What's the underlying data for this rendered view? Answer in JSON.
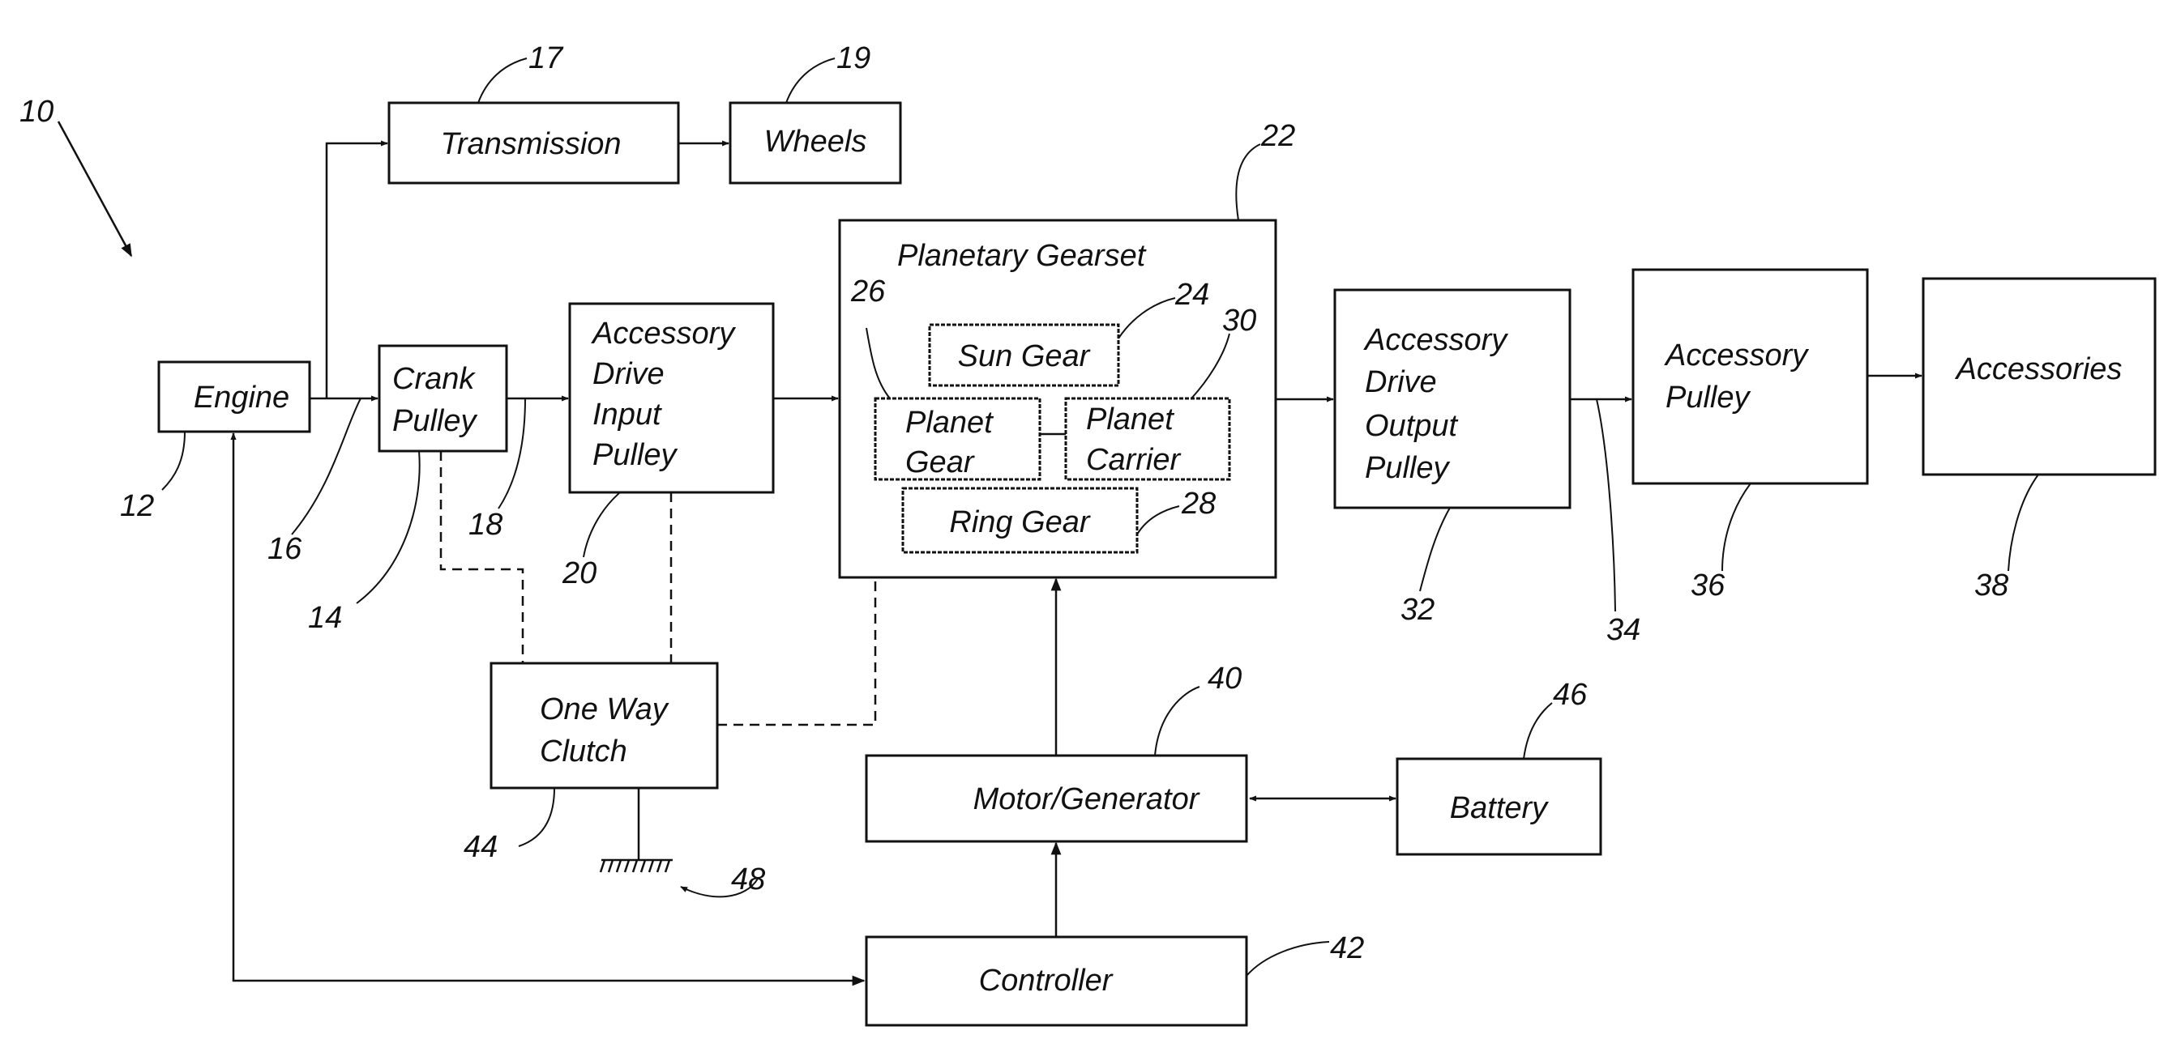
{
  "figure": {
    "system_ref": "10",
    "colors": {
      "ink": "#111111",
      "paper": "#ffffff"
    }
  },
  "blocks": {
    "engine": {
      "lines": [
        "Engine"
      ],
      "ref": "12"
    },
    "crank_pulley": {
      "lines": [
        "Crank",
        "Pulley"
      ],
      "ref": "14"
    },
    "transmission": {
      "lines": [
        "Transmission"
      ],
      "ref": "17"
    },
    "wheels": {
      "lines": [
        "Wheels"
      ],
      "ref": "19"
    },
    "accessory_drive_input_pulley": {
      "lines": [
        "Accessory",
        "Drive",
        "Input",
        "Pulley"
      ],
      "ref": "20"
    },
    "planetary_gearset": {
      "lines": [
        "Planetary Gearset"
      ],
      "ref": "22"
    },
    "sun_gear": {
      "lines": [
        "Sun Gear"
      ],
      "ref": "24"
    },
    "planet_gear": {
      "lines": [
        "Planet",
        "Gear"
      ],
      "ref": "26"
    },
    "ring_gear": {
      "lines": [
        "Ring Gear"
      ],
      "ref": "28"
    },
    "planet_carrier": {
      "lines": [
        "Planet",
        "Carrier"
      ],
      "ref": "30"
    },
    "accessory_drive_output_pulley": {
      "lines": [
        "Accessory",
        "Drive",
        "Output",
        "Pulley"
      ],
      "ref": "32"
    },
    "accessory_pulley": {
      "lines": [
        "Accessory",
        "Pulley"
      ],
      "ref": "36"
    },
    "accessories": {
      "lines": [
        "Accessories"
      ],
      "ref": "38"
    },
    "motor_generator": {
      "lines": [
        "Motor/Generator"
      ],
      "ref": "40"
    },
    "controller": {
      "lines": [
        "Controller"
      ],
      "ref": "42"
    },
    "one_way_clutch": {
      "lines": [
        "One Way",
        "Clutch"
      ],
      "ref": "44"
    },
    "battery": {
      "lines": [
        "Battery"
      ],
      "ref": "46"
    }
  },
  "connections": {
    "engine_output_ref": "16",
    "crank_output_ref": "18",
    "output_pulley_link_ref": "34",
    "ground_ref": "48"
  }
}
